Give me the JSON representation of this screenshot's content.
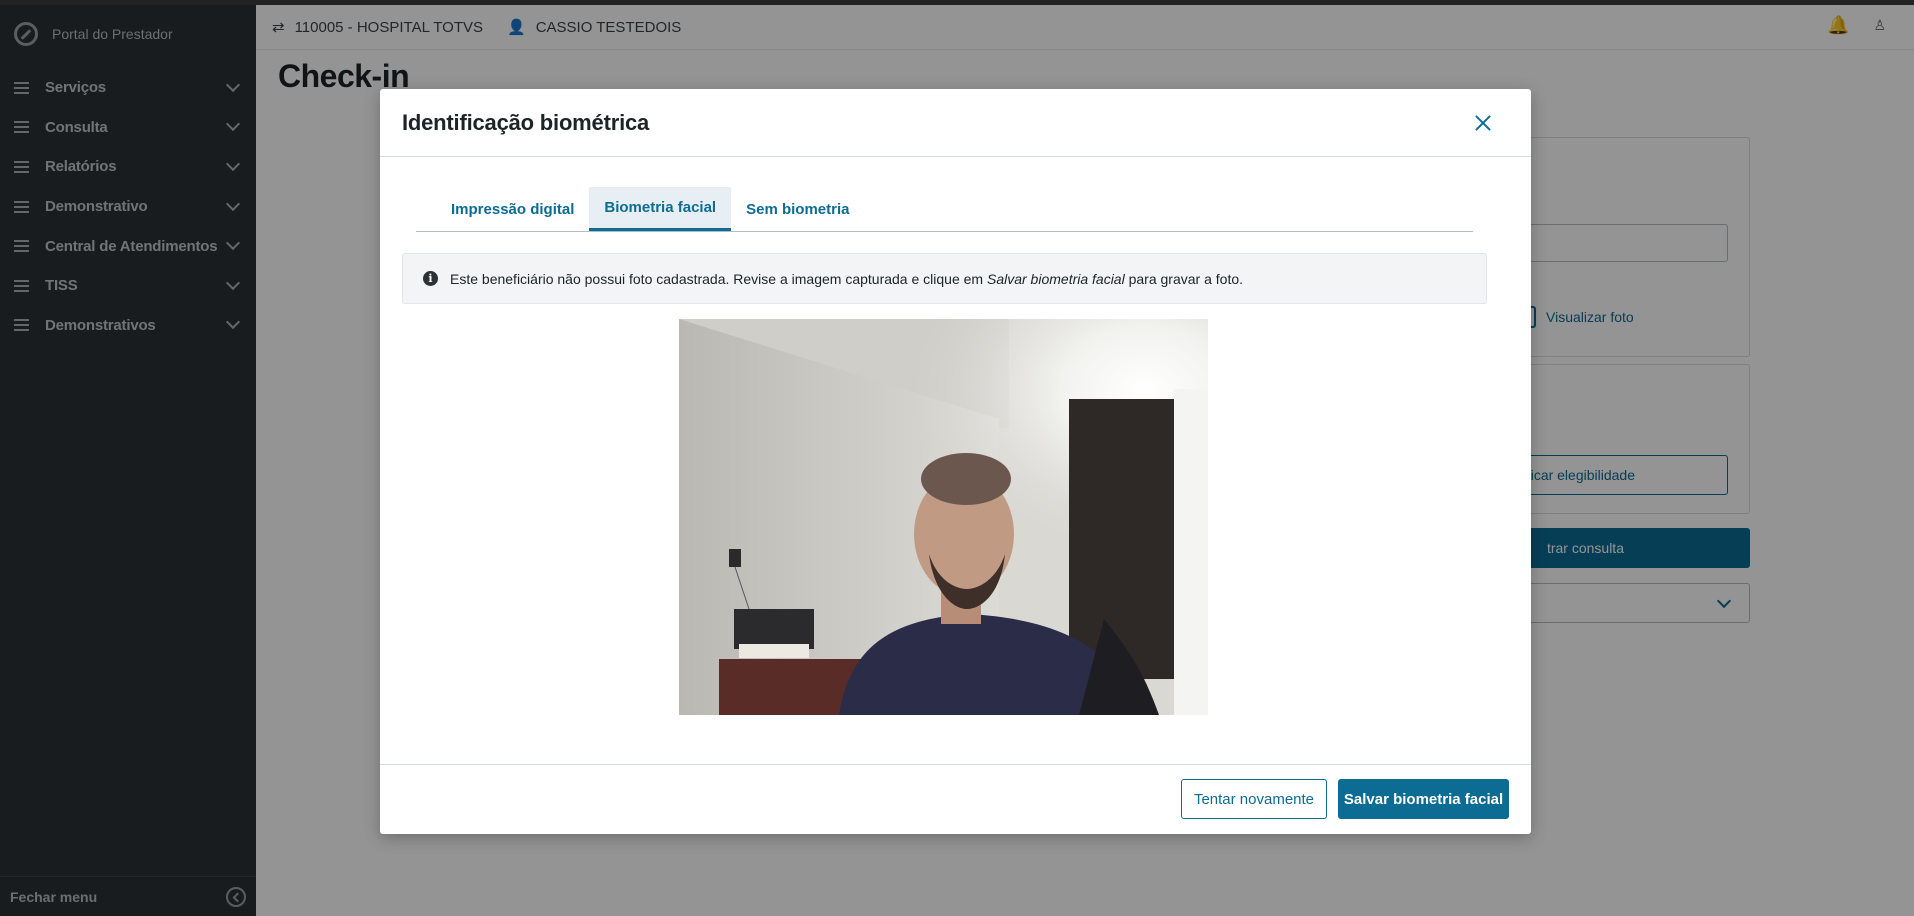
{
  "app": {
    "name": "Portal do Prestador"
  },
  "sidebar": {
    "items": [
      {
        "label": "Serviços"
      },
      {
        "label": "Consulta"
      },
      {
        "label": "Relatórios"
      },
      {
        "label": "Demonstrativo"
      },
      {
        "label": "Central de Atendimentos"
      },
      {
        "label": "TISS"
      },
      {
        "label": "Demonstrativos"
      }
    ],
    "footer_label": "Fechar menu"
  },
  "header": {
    "provider": "110005 - HOSPITAL TOTVS",
    "user": "CASSIO TESTEDOIS",
    "icons": [
      "swap-icon",
      "user-check-icon",
      "bell-icon",
      "user-icon"
    ]
  },
  "page": {
    "title": "Check-in",
    "view_photo_label": "Visualizar foto",
    "check_eligibility_label": "ficar elegibilidade",
    "register_consult_label": "trar consulta"
  },
  "modal": {
    "title": "Identificação biométrica",
    "tabs": [
      {
        "label": "Impressão digital",
        "active": false
      },
      {
        "label": "Biometria facial",
        "active": true
      },
      {
        "label": "Sem biometria",
        "active": false
      }
    ],
    "info": {
      "text_before": "Este beneficiário não possui foto cadastrada. Revise a imagem capturada e clique em",
      "text_emphasis": "Salvar biometria facial",
      "text_after": "para gravar a foto."
    },
    "buttons": {
      "retry": "Tentar novamente",
      "save": "Salvar biometria facial"
    }
  },
  "colors": {
    "primary": "#0c6c94",
    "sidebar_bg": "#2b3134"
  }
}
